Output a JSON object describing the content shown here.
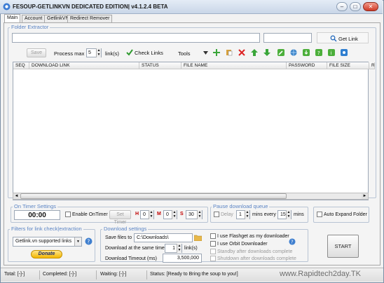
{
  "window": {
    "title": "FESOUP-GETLINKVN DEDICATED EDITION| v4.1.2.4 BETA",
    "minimize": "–",
    "maximize": "□",
    "close": "✕"
  },
  "tabs": [
    {
      "label": "Main",
      "active": true
    },
    {
      "label": "Account"
    },
    {
      "label": "GetlinkVN"
    },
    {
      "label": "Redirect Remover"
    }
  ],
  "folder_extractor": {
    "legend": "Folder Extractor",
    "url_value": "",
    "get_link_value": "",
    "get_link_label": "Get Link"
  },
  "toolbar": {
    "save_label": "Save",
    "process_max_label": "Process max",
    "process_max_value": "5",
    "links_unit": "link(s)",
    "check_links_label": "Check Links",
    "tools_label": "Tools"
  },
  "table": {
    "columns": [
      "SEQ",
      "DOWNLOAD LINK",
      "STATUS",
      "FILE NAME",
      "PASSWORD",
      "FILE SIZE",
      "R"
    ],
    "rows": []
  },
  "on_timer": {
    "legend": "On Timer Settings",
    "time": "00:00",
    "enable_label": "Enable OnTimer",
    "set_timer_label": "Set Timer",
    "h_label": "H",
    "h_value": "0",
    "m_label": "M",
    "m_value": "0",
    "s_label": "S",
    "s_value": "30"
  },
  "pause_queue": {
    "legend": "Pause download queue",
    "delay_label": "Delay",
    "delay_value": "1",
    "mins_every_label": "mins every",
    "every_value": "15",
    "mins_label": "mins"
  },
  "auto_expand_label": "Auto Expand Folder",
  "filters": {
    "legend": "Filters for link check|extraction",
    "selected": "Getlink.vn supported links",
    "donate_label": "Donate"
  },
  "download_settings": {
    "legend": "Download settings",
    "save_files_label": "Save files to",
    "save_path": "C:\\Downloads\\",
    "same_time_label": "Download at the same time",
    "same_time_value": "1",
    "same_time_unit": "link(s)",
    "timeout_label": "Download Timeout (ms)",
    "timeout_value": "3,500,000",
    "flashget_label": "I use Flashget as my downloader",
    "orbit_label": "I use Orbit Downloader",
    "standby_label": "Standby after downloads complete",
    "shutdown_label": "Shutdown after downloads complete"
  },
  "start_label": "START",
  "status": {
    "total": "Total: [-]-]",
    "completed": "Completed: [-]-]",
    "waiting": "Waiting: [-]-]",
    "status_text": "Status: [Ready to Bring the soup to you!]",
    "watermark": "www.Rapidtech2day.TK"
  },
  "colors": {
    "legend": "#5b84c4",
    "timer_red": "#c00000",
    "title_gradient_top": "#e4ecf6"
  }
}
